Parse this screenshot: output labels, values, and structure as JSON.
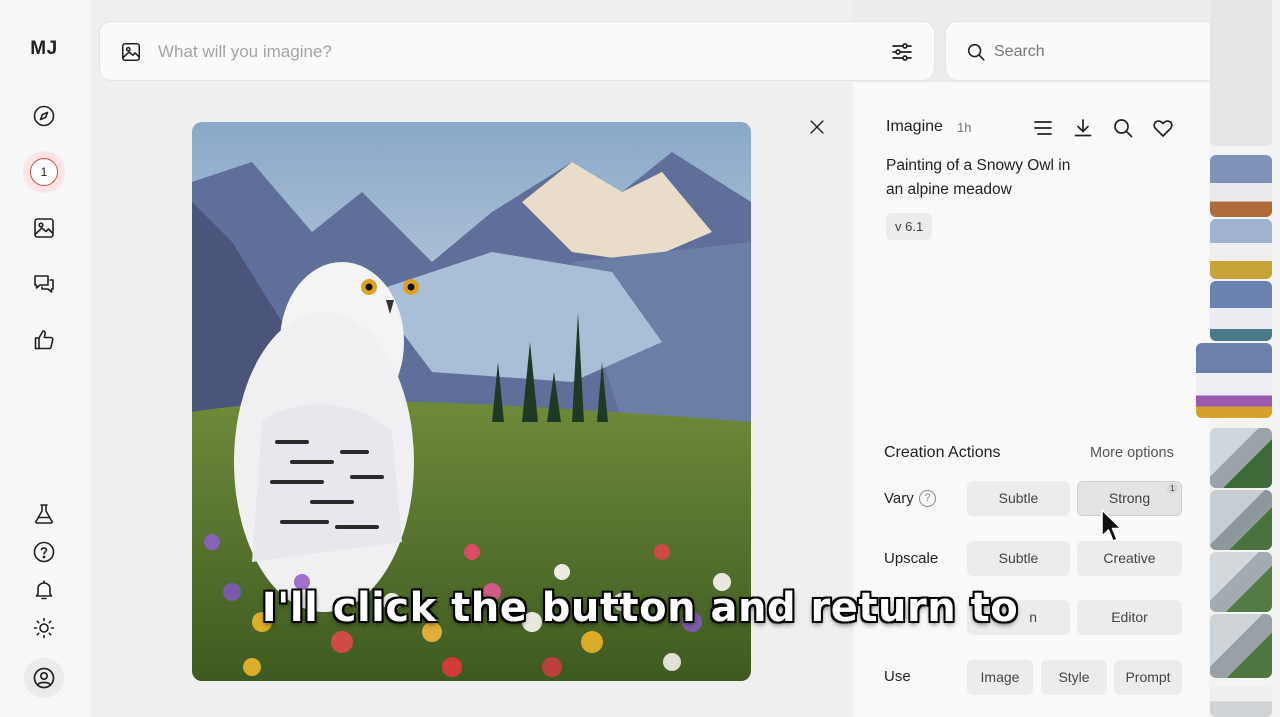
{
  "app": {
    "logo": "MJ"
  },
  "sidebar": {
    "notification_count": "1",
    "items": [
      {
        "icon": "compass-icon"
      },
      {
        "icon": "image-icon"
      },
      {
        "icon": "chat-icon"
      },
      {
        "icon": "thumbs-up-icon"
      },
      {
        "icon": "flask-icon"
      },
      {
        "icon": "help-icon"
      },
      {
        "icon": "bell-icon"
      },
      {
        "icon": "sun-icon"
      },
      {
        "icon": "account-icon"
      }
    ]
  },
  "imagine_bar": {
    "placeholder": "What will you imagine?"
  },
  "search_bar": {
    "placeholder": "Search"
  },
  "details": {
    "title": "Imagine",
    "time": "1h",
    "prompt": "Painting of a Snowy Owl in an alpine meadow",
    "version": "v 6.1"
  },
  "creation_actions": {
    "title": "Creation Actions",
    "more_options": "More options",
    "rows": [
      {
        "label": "Vary",
        "buttons": [
          "Subtle",
          "Strong"
        ],
        "active": "Strong",
        "badge": "1"
      },
      {
        "label": "Upscale",
        "buttons": [
          "Subtle",
          "Creative"
        ]
      },
      {
        "label": "",
        "buttons": [
          "n",
          "Editor"
        ]
      },
      {
        "label": "Use",
        "buttons": [
          "Image",
          "Style",
          "Prompt"
        ]
      }
    ]
  },
  "caption": "I'll click the button and return to",
  "colors": {
    "accent_red": "#d64545",
    "panel_bg": "#f9f9f9"
  }
}
